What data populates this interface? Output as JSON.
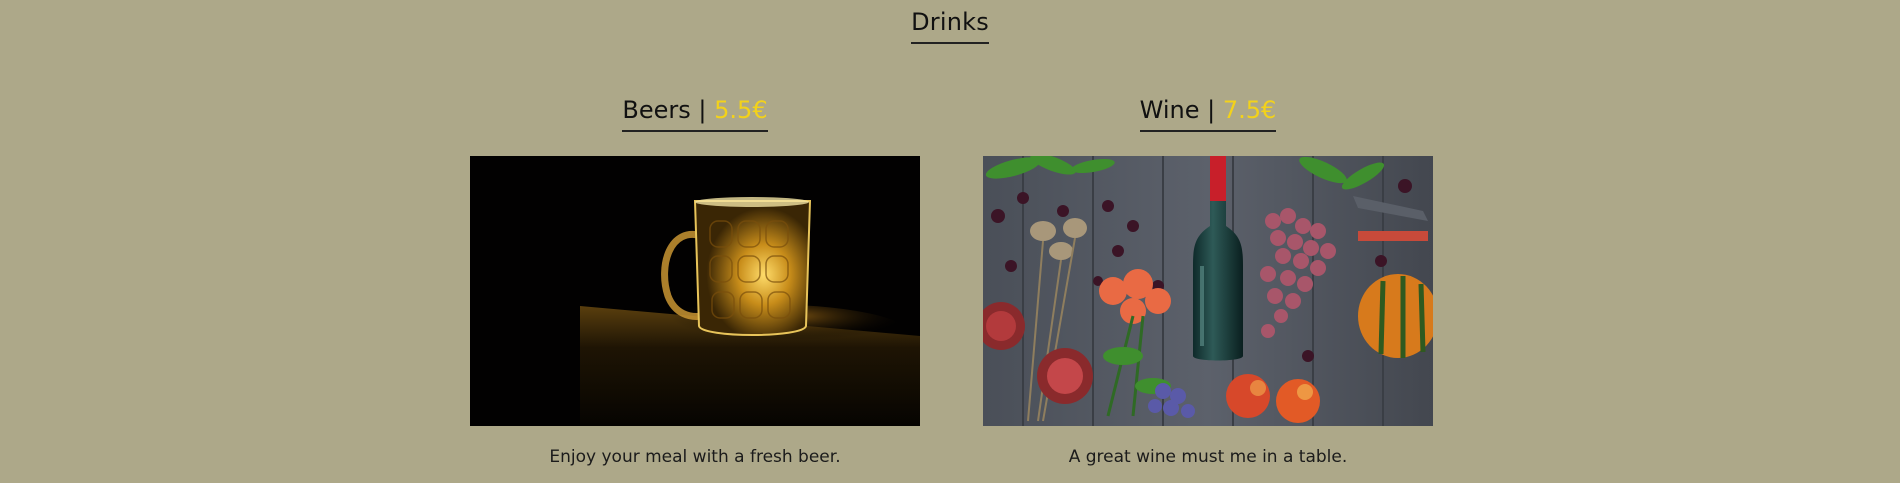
{
  "section": {
    "title": "Drinks"
  },
  "items": [
    {
      "name": "Beers",
      "separator": "|",
      "price": "5.5€",
      "description": "Enjoy your meal with a fresh beer.",
      "image_icon": "beer-mug-photo"
    },
    {
      "name": "Wine",
      "separator": "|",
      "price": "7.5€",
      "description": "A great wine must me in a table.",
      "image_icon": "wine-bottle-photo"
    }
  ],
  "colors": {
    "background": "#ada889",
    "price": "#f3d21a",
    "text": "#111111"
  }
}
